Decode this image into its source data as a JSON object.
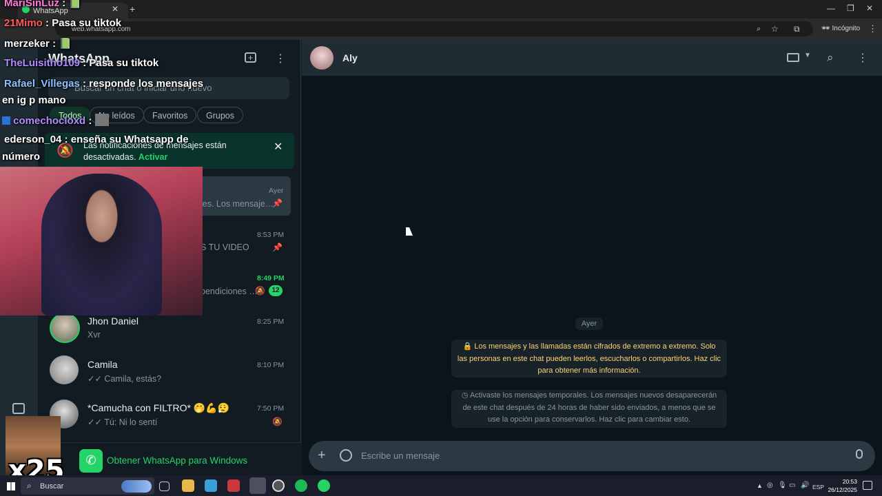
{
  "browser": {
    "tab_title": "WhatsApp",
    "url": "web.whatsapp.com",
    "incognito_label": "Incógnito"
  },
  "sidebar": {
    "app_title": "WhatsApp",
    "search_placeholder": "Buscar un chat o iniciar uno nuevo",
    "filters": [
      "Todos",
      "No leídos",
      "Favoritos",
      "Grupos"
    ],
    "notification_text": "Las notificaciones de mensajes están desactivadas.",
    "notification_action": "Activar",
    "get_app": "Obtener WhatsApp para Windows"
  },
  "chats": [
    {
      "name": "",
      "preview": "les. Los mensaje…",
      "time": "Ayer",
      "pinned": true
    },
    {
      "name": "",
      "preview": "S TU VIDEO",
      "time": "8:53 PM",
      "pinned": true
    },
    {
      "name": "",
      "preview": "pendiciones …",
      "time": "8:49 PM",
      "muted": true,
      "unread": "12"
    },
    {
      "name": "Jhon Daniel",
      "preview": "Xvr",
      "time": "8:25 PM"
    },
    {
      "name": "Camila",
      "preview": "✓✓ Camila, estás?",
      "time": "8:10 PM"
    },
    {
      "name": "*Camucha con FILTRO* 🤭💪😮‍💨",
      "preview": "✓✓ Tú: Ni lo sentí",
      "time": "7:50 PM",
      "muted": true
    }
  ],
  "conversation": {
    "contact_name": "Aly",
    "day_label": "Ayer",
    "encryption_notice": "🔒 Los mensajes y las llamadas están cifrados de extremo a extremo. Solo las personas en este chat pueden leerlos, escucharlos o compartirlos. Haz clic para obtener más información.",
    "temporary_notice": "Activaste los mensajes temporales. Los mensajes nuevos desaparecerán de este chat después de 24 horas de haber sido enviados, a menos que se use la opción para conservarlos. Haz clic para cambiar esto.",
    "composer_placeholder": "Escribe un mensaje"
  },
  "stream_chat": [
    {
      "user": "MariSinLuz",
      "color": "#ff7ad9",
      "text": ": 📗"
    },
    {
      "user": "21Mimo",
      "color": "#ff5a5a",
      "text": ": Pasa su tiktok"
    },
    {
      "user": "merzeker",
      "color": "#ffffff",
      "text": ": 📗"
    },
    {
      "user": "TheLuisitho109",
      "color": "#b28bff",
      "text": ": Pasa su tiktok"
    },
    {
      "user": "Rafael_Villegas",
      "color": "#8fc1ff",
      "text": ": responde los mensajes"
    },
    {
      "user": "",
      "color": "#ffffff",
      "text": "en ig p mano"
    },
    {
      "user": "comechocloxd",
      "color": "#b28bff",
      "text": ":"
    },
    {
      "user": "ederson_04",
      "color": "#ffffff",
      "text": ": enseña su Whatsapp de"
    },
    {
      "user": "",
      "color": "#ffffff",
      "text": "número"
    }
  ],
  "overlay": {
    "multiplier": "x25"
  },
  "taskbar": {
    "search_label": "Buscar",
    "language": "ESP",
    "time": "20:53",
    "date": "26/12/2025"
  }
}
